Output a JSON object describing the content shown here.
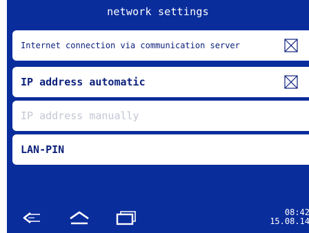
{
  "header": {
    "title": "network settings"
  },
  "settings": {
    "items": [
      {
        "label": "Internet connection via communication server",
        "checked": true,
        "enabled": true
      },
      {
        "label": "IP address automatic",
        "checked": true,
        "enabled": true
      },
      {
        "label": "IP address manually",
        "enabled": false
      },
      {
        "label": "LAN-PIN",
        "enabled": true
      }
    ]
  },
  "navbar": {
    "icons": [
      "back-icon",
      "home-icon",
      "recent-apps-icon"
    ],
    "time": "08:42",
    "date": "15.08.14"
  },
  "colors": {
    "panel_blue": "#0a2d9c",
    "text_dark_blue": "#0a1f7a",
    "disabled_text": "#c2c7d4",
    "white": "#ffffff"
  }
}
